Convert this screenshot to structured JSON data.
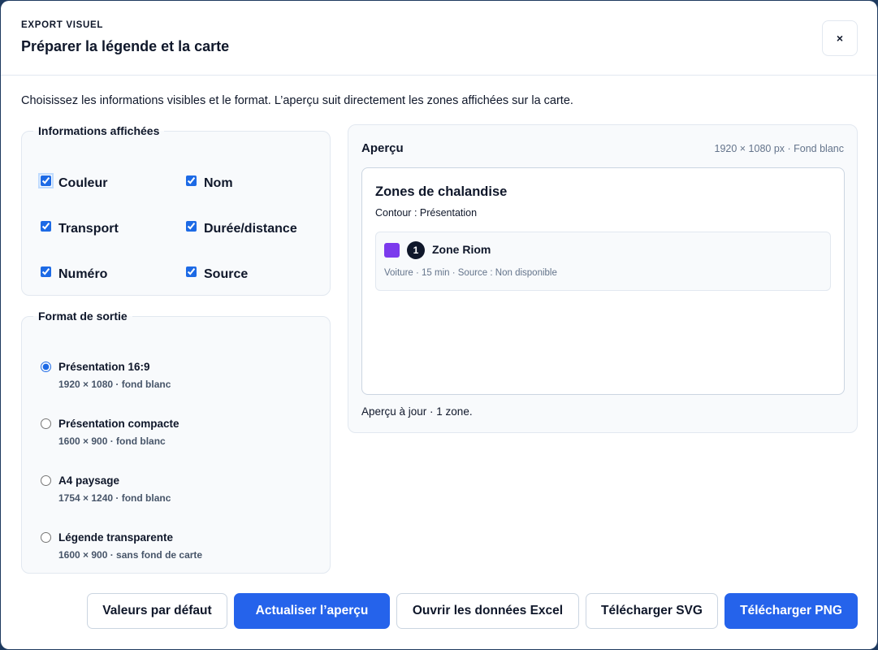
{
  "header": {
    "eyebrow": "EXPORT VISUEL",
    "title": "Préparer la légende et la carte",
    "close_label": "×"
  },
  "intro": "Choisissez les informations visibles et le format. L’aperçu suit directement les zones affichées sur la carte.",
  "info_section": {
    "legend": "Informations affichées",
    "options": [
      {
        "label": "Couleur",
        "checked": true
      },
      {
        "label": "Nom",
        "checked": true
      },
      {
        "label": "Transport",
        "checked": true
      },
      {
        "label": "Durée/distance",
        "checked": true
      },
      {
        "label": "Numéro",
        "checked": true
      },
      {
        "label": "Source",
        "checked": true
      }
    ]
  },
  "format_section": {
    "legend": "Format de sortie",
    "options": [
      {
        "title": "Présentation 16:9",
        "sub": "1920 × 1080 · fond blanc",
        "selected": true
      },
      {
        "title": "Présentation compacte",
        "sub": "1600 × 900 · fond blanc",
        "selected": false
      },
      {
        "title": "A4 paysage",
        "sub": "1754 × 1240 · fond blanc",
        "selected": false
      },
      {
        "title": "Légende transparente",
        "sub": "1600 × 900 · sans fond de carte",
        "selected": false
      }
    ]
  },
  "preview": {
    "title": "Aperçu",
    "meta": "1920 × 1080 px · Fond blanc",
    "card_title": "Zones de chalandise",
    "card_subtitle": "Contour : Présentation",
    "zones": [
      {
        "number": "1",
        "name": "Zone Riom",
        "details": "Voiture · 15 min · Source : Non disponible",
        "color": "#7c3aed"
      }
    ],
    "status": "Aperçu à jour · 1 zone."
  },
  "buttons": {
    "defaults": "Valeurs par défaut",
    "refresh": "Actualiser l’aperçu",
    "excel": "Ouvrir les données Excel",
    "svg": "Télécharger SVG",
    "png": "Télécharger PNG"
  },
  "colors": {
    "primary": "#2563eb",
    "zone_swatch": "#7c3aed",
    "text": "#0f172a"
  }
}
